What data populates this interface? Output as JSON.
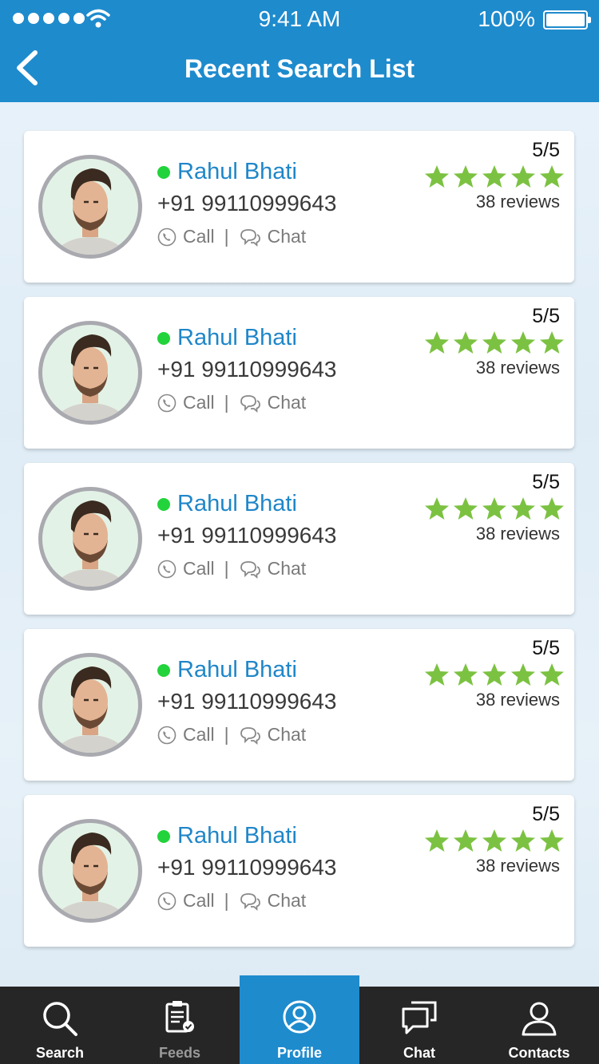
{
  "status_bar": {
    "time": "9:41 AM",
    "battery": "100%"
  },
  "header": {
    "title": "Recent Search List"
  },
  "results": [
    {
      "name": "Rahul Bhati",
      "phone": "+91 99110999643",
      "call_label": "Call",
      "chat_label": "Chat",
      "separator": "|",
      "score": "5/5",
      "rating": 5,
      "reviews": "38 reviews"
    },
    {
      "name": "Rahul Bhati",
      "phone": "+91 99110999643",
      "call_label": "Call",
      "chat_label": "Chat",
      "separator": "|",
      "score": "5/5",
      "rating": 5,
      "reviews": "38 reviews"
    },
    {
      "name": "Rahul Bhati",
      "phone": "+91 99110999643",
      "call_label": "Call",
      "chat_label": "Chat",
      "separator": "|",
      "score": "5/5",
      "rating": 5,
      "reviews": "38 reviews"
    },
    {
      "name": "Rahul Bhati",
      "phone": "+91 99110999643",
      "call_label": "Call",
      "chat_label": "Chat",
      "separator": "|",
      "score": "5/5",
      "rating": 5,
      "reviews": "38 reviews"
    },
    {
      "name": "Rahul Bhati",
      "phone": "+91 99110999643",
      "call_label": "Call",
      "chat_label": "Chat",
      "separator": "|",
      "score": "5/5",
      "rating": 5,
      "reviews": "38 reviews"
    }
  ],
  "tabbar": {
    "items": [
      {
        "label": "Search",
        "icon": "search-icon"
      },
      {
        "label": "Feeds",
        "icon": "feeds-icon"
      },
      {
        "label": "Profile",
        "icon": "profile-icon",
        "active": true
      },
      {
        "label": "Chat",
        "icon": "chat-icon"
      },
      {
        "label": "Contacts",
        "icon": "contacts-icon"
      }
    ]
  },
  "colors": {
    "primary": "#1e8bcd",
    "star": "#7cc242",
    "online": "#22d33b",
    "tabbar_bg": "#262626"
  }
}
